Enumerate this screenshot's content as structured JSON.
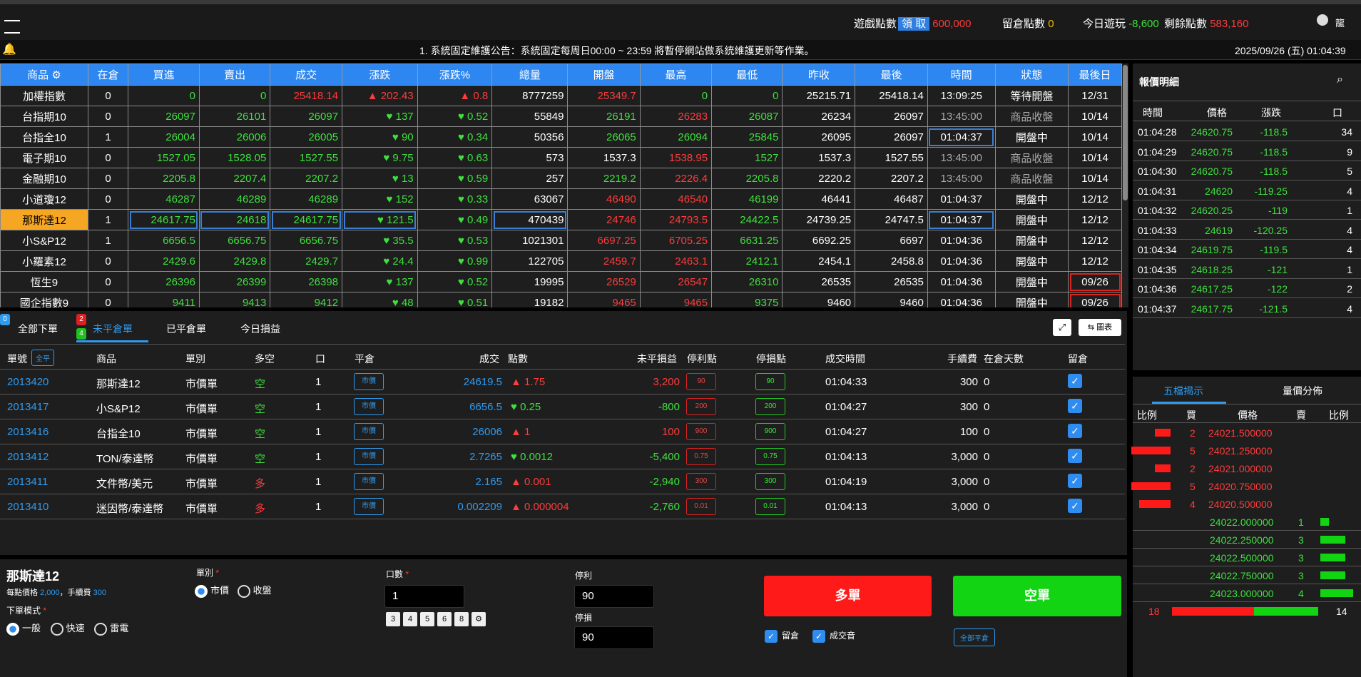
{
  "topbar": {
    "game_points_label": "遊戲點數",
    "claim_label": "領 取",
    "game_points_value": "600,000",
    "reserve_label": "留倉點數",
    "reserve_value": "0",
    "today_label": "今日遊玩",
    "today_value": "-8,600",
    "remain_label": "剩餘點數",
    "remain_value": "583,160",
    "user_label": "龍"
  },
  "ticker": {
    "notice": "1. 系統固定維護公告：系統固定每周日00:00 ~ 23:59 將暫停網站做系統維護更新等作業。",
    "datetime": "2025/09/26 (五) 01:04:39"
  },
  "quote": {
    "headers": [
      "商品 ⚙",
      "在倉",
      "買進",
      "賣出",
      "成交",
      "漲跌",
      "漲跌%",
      "總量",
      "開盤",
      "最高",
      "最低",
      "昨收",
      "最後",
      "時間",
      "狀態",
      "最後日"
    ],
    "rows": [
      [
        "加權指數",
        "0",
        "0",
        "0",
        "25418.14",
        "▲ 202.43",
        "▲ 0.8",
        "8777259",
        "25349.7",
        "0",
        "0",
        "25215.71",
        "25418.14",
        "13:09:25",
        "等待開盤",
        "12/31"
      ],
      [
        "台指期10",
        "0",
        "26097",
        "26101",
        "26097",
        "♥ 137",
        "♥ 0.52",
        "55849",
        "26191",
        "26283",
        "26087",
        "26234",
        "26097",
        "13:45:00",
        "商品收盤",
        "10/14"
      ],
      [
        "台指全10",
        "1",
        "26004",
        "26006",
        "26005",
        "♥ 90",
        "♥ 0.34",
        "50356",
        "26065",
        "26094",
        "25845",
        "26095",
        "26097",
        "01:04:37",
        "開盤中",
        "10/14"
      ],
      [
        "電子期10",
        "0",
        "1527.05",
        "1528.05",
        "1527.55",
        "♥ 9.75",
        "♥ 0.63",
        "573",
        "1537.3",
        "1538.95",
        "1527",
        "1537.3",
        "1527.55",
        "13:45:00",
        "商品收盤",
        "10/14"
      ],
      [
        "金融期10",
        "0",
        "2205.8",
        "2207.4",
        "2207.2",
        "♥ 13",
        "♥ 0.59",
        "257",
        "2219.2",
        "2226.4",
        "2205.8",
        "2220.2",
        "2207.2",
        "13:45:00",
        "商品收盤",
        "10/14"
      ],
      [
        "小道瓊12",
        "0",
        "46287",
        "46289",
        "46289",
        "♥ 152",
        "♥ 0.33",
        "63067",
        "46490",
        "46540",
        "46199",
        "46441",
        "46487",
        "01:04:37",
        "開盤中",
        "12/12"
      ],
      [
        "那斯達12",
        "1",
        "24617.75",
        "24618",
        "24617.75",
        "♥ 121.5",
        "♥ 0.49",
        "470439",
        "24746",
        "24793.5",
        "24422.5",
        "24739.25",
        "24747.5",
        "01:04:37",
        "開盤中",
        "12/12"
      ],
      [
        "小S&P12",
        "1",
        "6656.5",
        "6656.75",
        "6656.75",
        "♥ 35.5",
        "♥ 0.53",
        "1021301",
        "6697.25",
        "6705.25",
        "6631.25",
        "6692.25",
        "6697",
        "01:04:36",
        "開盤中",
        "12/12"
      ],
      [
        "小羅素12",
        "0",
        "2429.6",
        "2429.8",
        "2429.7",
        "♥ 24.4",
        "♥ 0.99",
        "122705",
        "2459.7",
        "2463.1",
        "2412.1",
        "2454.1",
        "2458.8",
        "01:04:36",
        "開盤中",
        "12/12"
      ],
      [
        "恆生9",
        "0",
        "26396",
        "26399",
        "26398",
        "♥ 137",
        "♥ 0.52",
        "19995",
        "26529",
        "26547",
        "26310",
        "26535",
        "26535",
        "01:04:36",
        "開盤中",
        "09/26"
      ],
      [
        "國企指數9",
        "0",
        "9411",
        "9413",
        "9412",
        "♥ 48",
        "♥ 0.51",
        "19182",
        "9465",
        "9465",
        "9375",
        "9460",
        "9460",
        "01:04:36",
        "開盤中",
        "09/26"
      ]
    ]
  },
  "tabs": {
    "all_orders": "全部下單",
    "open_orders": "未平倉單",
    "closed_orders": "已平倉單",
    "today_pnl": "今日損益",
    "badge_all": "0",
    "badge_open_red": "2",
    "badge_open_green": "4",
    "chart_btn": "圖表"
  },
  "orders": {
    "headers": {
      "no": "單號",
      "close_all": "全平",
      "product": "商品",
      "type": "單別",
      "side": "多空",
      "qty": "口",
      "flat": "平倉",
      "price": "成交",
      "points": "點數",
      "pnl": "未平損益",
      "tp": "停利點",
      "sl": "停損點",
      "time": "成交時間",
      "fee": "手續費",
      "days": "在倉天數",
      "keep": "留倉"
    },
    "flat_label": "市價",
    "rows": [
      {
        "no": "2013420",
        "product": "那斯達12",
        "type": "市價單",
        "side": "空",
        "qty": "1",
        "price": "24619.5",
        "points": "▲ 1.75",
        "pnl": "3,200",
        "tp": "90",
        "sl": "90",
        "time": "01:04:33",
        "fee": "300",
        "days": "0"
      },
      {
        "no": "2013417",
        "product": "小S&P12",
        "type": "市價單",
        "side": "空",
        "qty": "1",
        "price": "6656.5",
        "points": "♥ 0.25",
        "pnl": "-800",
        "tp": "200",
        "sl": "200",
        "time": "01:04:27",
        "fee": "300",
        "days": "0"
      },
      {
        "no": "2013416",
        "product": "台指全10",
        "type": "市價單",
        "side": "空",
        "qty": "1",
        "price": "26006",
        "points": "▲ 1",
        "pnl": "100",
        "tp": "900",
        "sl": "900",
        "time": "01:04:27",
        "fee": "100",
        "days": "0"
      },
      {
        "no": "2013412",
        "product": "TON/泰達幣",
        "type": "市價單",
        "side": "空",
        "qty": "1",
        "price": "2.7265",
        "points": "♥ 0.0012",
        "pnl": "-5,400",
        "tp": "0.75",
        "sl": "0.75",
        "time": "01:04:13",
        "fee": "3,000",
        "days": "0"
      },
      {
        "no": "2013411",
        "product": "文件幣/美元",
        "type": "市價單",
        "side": "多",
        "qty": "1",
        "price": "2.165",
        "points": "▲ 0.001",
        "pnl": "-2,940",
        "tp": "300",
        "sl": "300",
        "time": "01:04:19",
        "fee": "3,000",
        "days": "0"
      },
      {
        "no": "2013410",
        "product": "迷因幣/泰達幣",
        "type": "市價單",
        "side": "多",
        "qty": "1",
        "price": "0.002209",
        "points": "▲ 0.000004",
        "pnl": "-2,760",
        "tp": "0.01",
        "sl": "0.01",
        "time": "01:04:13",
        "fee": "3,000",
        "days": "0"
      }
    ]
  },
  "entry": {
    "product": "那斯達12",
    "point_price_label": "每點價格",
    "point_price": "2,000",
    "fee_label": "，手續費",
    "fee": "300",
    "mode_label": "下單模式",
    "mode_options": [
      "一般",
      "快速",
      "雷電"
    ],
    "type_label": "單別",
    "type_options": [
      "市價",
      "收盤"
    ],
    "qty_label": "口數",
    "qty_value": "1",
    "qty_quick": [
      "3",
      "4",
      "5",
      "6",
      "8",
      "⚙"
    ],
    "tp_label": "停利",
    "tp_value": "90",
    "sl_label": "停損",
    "sl_value": "90",
    "buy_label": "多單",
    "sell_label": "空單",
    "keep_label": "留倉",
    "sound_label": "成交音",
    "close_all": "全部平倉"
  },
  "detail": {
    "title": "報價明細",
    "headers": [
      "時間",
      "價格",
      "漲跌",
      "口"
    ],
    "rows": [
      [
        "01:04:28",
        "24620.75",
        "-118.5",
        "34"
      ],
      [
        "01:04:29",
        "24620.75",
        "-118.5",
        "9"
      ],
      [
        "01:04:30",
        "24620.75",
        "-118.5",
        "5"
      ],
      [
        "01:04:31",
        "24620",
        "-119.25",
        "4"
      ],
      [
        "01:04:32",
        "24620.25",
        "-119",
        "1"
      ],
      [
        "01:04:33",
        "24619",
        "-120.25",
        "4"
      ],
      [
        "01:04:34",
        "24619.75",
        "-119.5",
        "4"
      ],
      [
        "01:04:35",
        "24618.25",
        "-121",
        "1"
      ],
      [
        "01:04:36",
        "24617.25",
        "-122",
        "2"
      ],
      [
        "01:04:37",
        "24617.75",
        "-121.5",
        "4"
      ]
    ]
  },
  "depth": {
    "tab1": "五檔揭示",
    "tab2": "量價分佈",
    "headers": [
      "比例",
      "買",
      "價格",
      "賣",
      "比例"
    ],
    "asks": [
      {
        "qty": "2",
        "price": "24021.500000",
        "ratio": 0.4
      },
      {
        "qty": "5",
        "price": "24021.250000",
        "ratio": 1.0
      },
      {
        "qty": "2",
        "price": "24021.000000",
        "ratio": 0.4
      },
      {
        "qty": "5",
        "price": "24020.750000",
        "ratio": 1.0
      },
      {
        "qty": "4",
        "price": "24020.500000",
        "ratio": 0.8
      }
    ],
    "bids": [
      {
        "qty": "1",
        "price": "24022.000000",
        "ratio": 0.25
      },
      {
        "qty": "3",
        "price": "24022.250000",
        "ratio": 0.75
      },
      {
        "qty": "3",
        "price": "24022.500000",
        "ratio": 0.75
      },
      {
        "qty": "3",
        "price": "24022.750000",
        "ratio": 0.75
      },
      {
        "qty": "4",
        "price": "24023.000000",
        "ratio": 1.0
      }
    ],
    "total_left": "18",
    "total_right": "14",
    "total_ratio": 0.5625
  }
}
